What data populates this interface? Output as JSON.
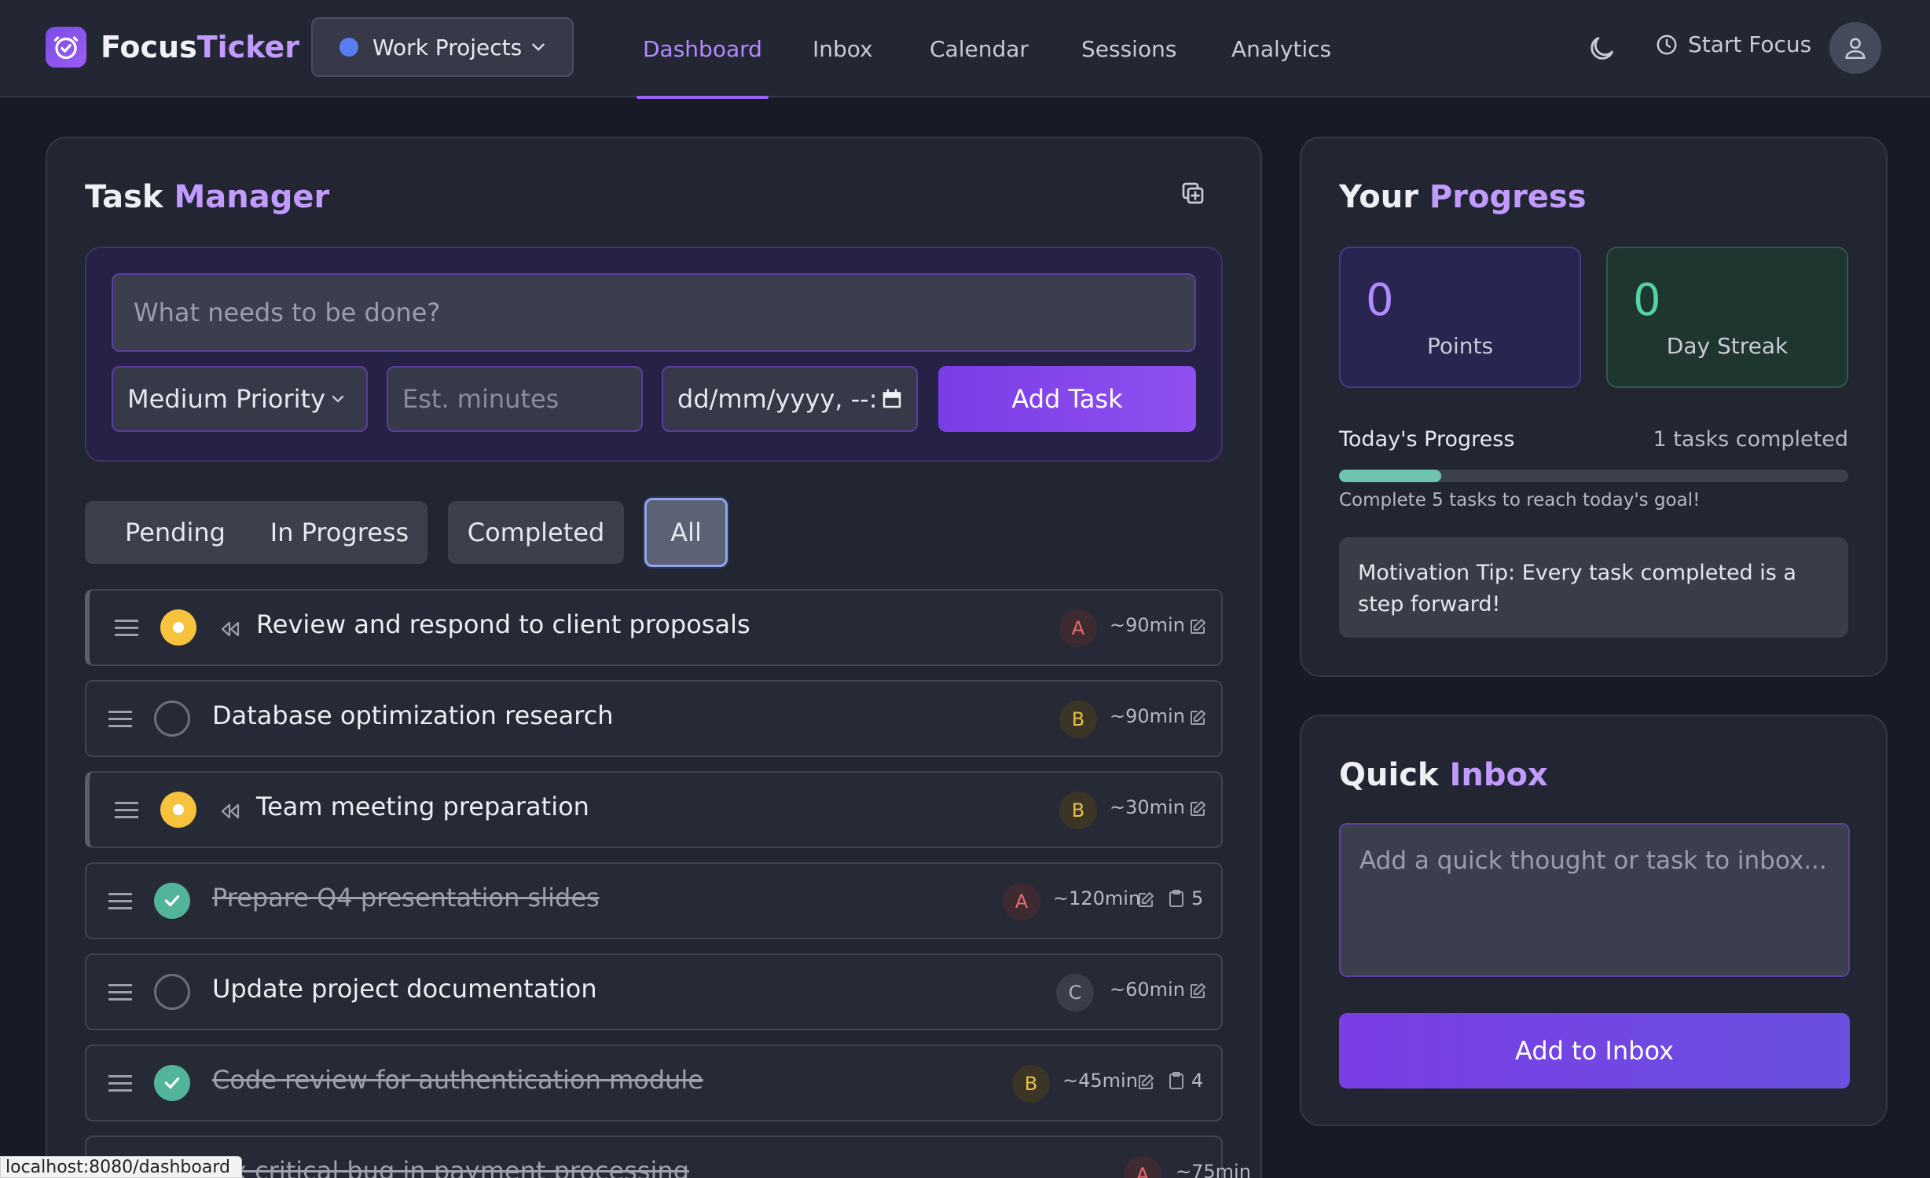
{
  "app": {
    "name_part1": "Focus",
    "name_part2": "Ticker",
    "accent_color": "#9a62f0"
  },
  "workspace": {
    "label": "Work Projects",
    "dot_color": "#5a7ef2"
  },
  "nav": {
    "items": [
      {
        "label": "Dashboard",
        "active": true
      },
      {
        "label": "Inbox",
        "active": false
      },
      {
        "label": "Calendar",
        "active": false
      },
      {
        "label": "Sessions",
        "active": false
      },
      {
        "label": "Analytics",
        "active": false
      }
    ],
    "start_focus": "Start Focus"
  },
  "task_manager": {
    "title_part1": "Task",
    "title_part2": "Manager",
    "input_placeholder": "What needs to be done?",
    "priority": "Medium Priority",
    "est_placeholder": "Est. minutes",
    "date_placeholder": "dd/mm/yyyy, --:",
    "add_button": "Add Task",
    "filters": [
      {
        "label": "Pending",
        "selected": false
      },
      {
        "label": "In Progress",
        "selected": false
      },
      {
        "label": "Completed",
        "selected": false
      },
      {
        "label": "All",
        "selected": true
      }
    ],
    "tasks": [
      {
        "title": "Review and respond to client proposals",
        "status": "in-progress",
        "priority": "A",
        "est": "~90min"
      },
      {
        "title": "Database optimization research",
        "status": "pending",
        "priority": "B",
        "est": "~90min"
      },
      {
        "title": "Team meeting preparation",
        "status": "in-progress",
        "priority": "B",
        "est": "~30min"
      },
      {
        "title": "Prepare Q4 presentation slides",
        "status": "completed",
        "priority": "A",
        "est": "~120min",
        "subtasks": "5"
      },
      {
        "title": "Update project documentation",
        "status": "pending",
        "priority": "C",
        "est": "~60min"
      },
      {
        "title": "Code review for authentication module",
        "status": "completed",
        "priority": "B",
        "est": "~45min",
        "subtasks": "4"
      },
      {
        "title": "Fix critical bug in payment processing",
        "status": "completed",
        "priority": "A",
        "est": "~75min"
      }
    ]
  },
  "progress": {
    "title_part1": "Your",
    "title_part2": "Progress",
    "points_value": "0",
    "points_label": "Points",
    "streak_value": "0",
    "streak_label": "Day Streak",
    "today_label": "Today's Progress",
    "today_count": "1 tasks completed",
    "progress_fraction": 0.2,
    "goal_text": "Complete 5 tasks to reach today's goal!",
    "tip": "Motivation Tip: Every task completed is a step forward!"
  },
  "quick_inbox": {
    "title_part1": "Quick",
    "title_part2": "Inbox",
    "placeholder": "Add a quick thought or task to inbox...",
    "button": "Add to Inbox"
  },
  "status_bar": {
    "url": "localhost:8080/dashboard"
  }
}
